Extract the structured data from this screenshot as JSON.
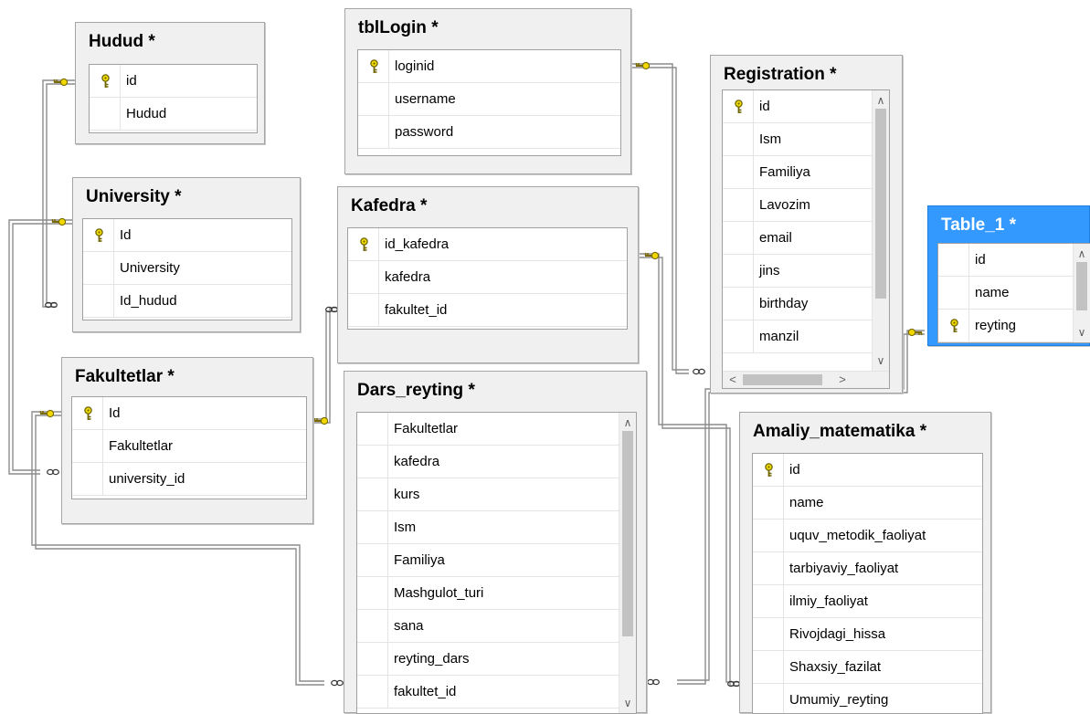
{
  "tables": {
    "hudud": {
      "title": "Hudud *",
      "columns": [
        {
          "name": "id",
          "pk": true
        },
        {
          "name": "Hudud",
          "pk": false
        }
      ]
    },
    "tbllogin": {
      "title": "tblLogin *",
      "columns": [
        {
          "name": "loginid",
          "pk": true
        },
        {
          "name": "username",
          "pk": false
        },
        {
          "name": "password",
          "pk": false
        }
      ]
    },
    "registration": {
      "title": "Registration *",
      "columns": [
        {
          "name": "id",
          "pk": true
        },
        {
          "name": "Ism",
          "pk": false
        },
        {
          "name": "Familiya",
          "pk": false
        },
        {
          "name": "Lavozim",
          "pk": false
        },
        {
          "name": "email",
          "pk": false
        },
        {
          "name": "jins",
          "pk": false
        },
        {
          "name": "birthday",
          "pk": false
        },
        {
          "name": "manzil",
          "pk": false
        }
      ]
    },
    "table1": {
      "title": "Table_1 *",
      "columns": [
        {
          "name": "id",
          "pk": false
        },
        {
          "name": "name",
          "pk": false
        },
        {
          "name": "reyting",
          "pk": true
        }
      ]
    },
    "university": {
      "title": "University *",
      "columns": [
        {
          "name": "Id",
          "pk": true
        },
        {
          "name": "University",
          "pk": false
        },
        {
          "name": "Id_hudud",
          "pk": false
        }
      ]
    },
    "kafedra": {
      "title": "Kafedra *",
      "columns": [
        {
          "name": "id_kafedra",
          "pk": true
        },
        {
          "name": "kafedra",
          "pk": false
        },
        {
          "name": "fakultet_id",
          "pk": false
        }
      ]
    },
    "fakultetlar": {
      "title": "Fakultetlar *",
      "columns": [
        {
          "name": "Id",
          "pk": true
        },
        {
          "name": "Fakultetlar",
          "pk": false
        },
        {
          "name": "university_id",
          "pk": false
        }
      ]
    },
    "dars_reyting": {
      "title": "Dars_reyting *",
      "columns": [
        {
          "name": "Fakultetlar",
          "pk": false
        },
        {
          "name": "kafedra",
          "pk": false
        },
        {
          "name": "kurs",
          "pk": false
        },
        {
          "name": "Ism",
          "pk": false
        },
        {
          "name": "Familiya",
          "pk": false
        },
        {
          "name": "Mashgulot_turi",
          "pk": false
        },
        {
          "name": "sana",
          "pk": false
        },
        {
          "name": "reyting_dars",
          "pk": false
        },
        {
          "name": "fakultet_id",
          "pk": false
        }
      ]
    },
    "amaliy": {
      "title": "Amaliy_matematika *",
      "columns": [
        {
          "name": "id",
          "pk": true
        },
        {
          "name": "name",
          "pk": false
        },
        {
          "name": "uquv_metodik_faoliyat",
          "pk": false
        },
        {
          "name": "tarbiyaviy_faoliyat",
          "pk": false
        },
        {
          "name": "ilmiy_faoliyat",
          "pk": false
        },
        {
          "name": "Rivojdagi_hissa",
          "pk": false
        },
        {
          "name": "Shaxsiy_fazilat",
          "pk": false
        },
        {
          "name": "Umumiy_reyting",
          "pk": false
        }
      ]
    }
  },
  "icons": {
    "primary_key": "key-icon",
    "relationship_one": "key-endpoint-icon",
    "relationship_many": "infinity-endpoint-icon"
  },
  "colors": {
    "selected_table": "#3399ff",
    "key": "#e0c800",
    "connector": "#8c8c8c"
  }
}
